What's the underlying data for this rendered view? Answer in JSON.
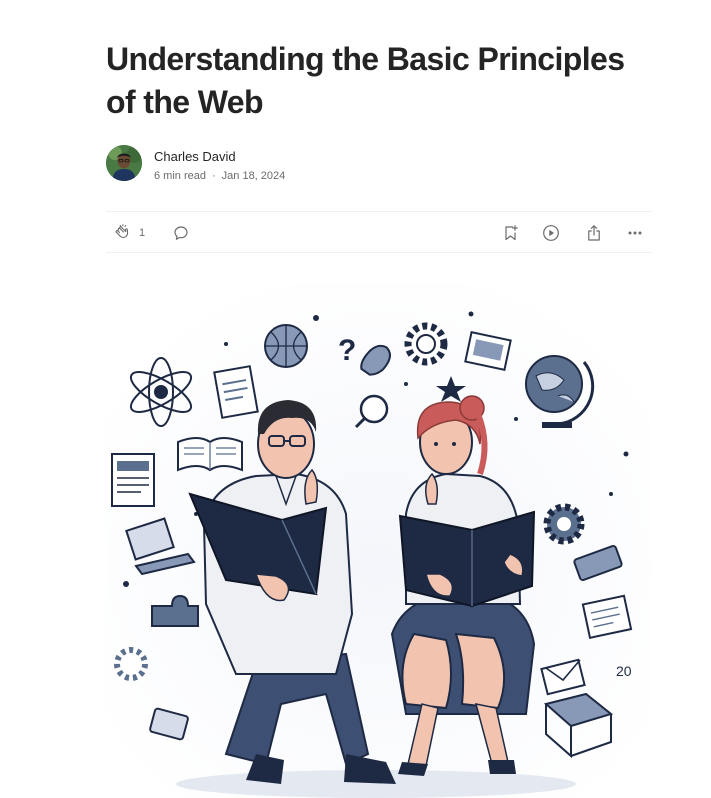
{
  "article": {
    "title": "Understanding the Basic Principles of the Web",
    "author": "Charles David",
    "read_time": "6 min read",
    "separator": "·",
    "date": "Jan 18, 2024"
  },
  "actions": {
    "clap_count": "1",
    "icons": [
      "clap-icon",
      "comment-icon",
      "bookmark-add-icon",
      "play-icon",
      "share-icon",
      "more-icon"
    ]
  },
  "hero": {
    "scene": "two people reading books surrounded by web icons",
    "decor_text": "20",
    "colors": {
      "navy": "#1e2a44",
      "slate": "#5b6f8f",
      "skin": "#f2c4b0",
      "hair_red": "#c95c5a",
      "hair_dark": "#2b2b33",
      "shirt": "#eef0f4"
    }
  }
}
